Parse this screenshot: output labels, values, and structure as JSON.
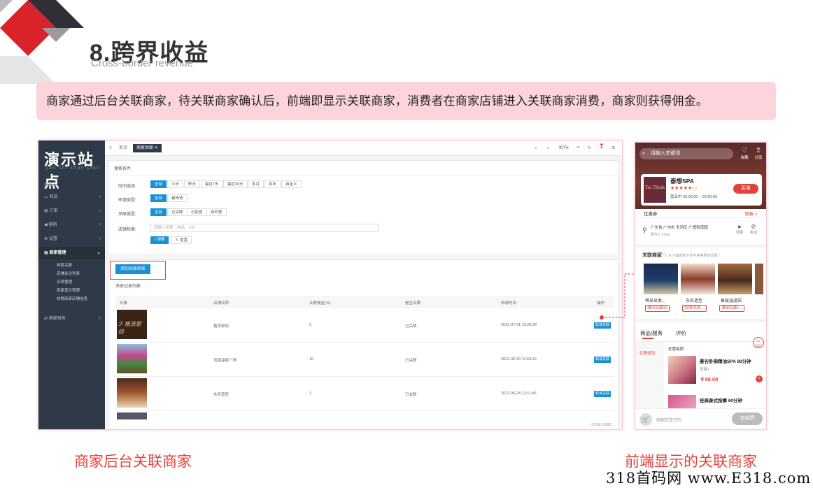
{
  "slide": {
    "title": "8.跨界收益",
    "subtitle": "Cross-border revenue",
    "banner": "商家通过后台关联商家，待关联商家确认后，前端即显示关联商家，消费者在商家店铺进入关联商家消费，商家则获得佣金。",
    "caption_left": "商家后台关联商家",
    "caption_right": "前端显示的关联商家",
    "watermark": "318首码网 www.E318.com"
  },
  "admin": {
    "logo": "演示站点",
    "logo_sub": "yan shi zhan dian",
    "home_label": "商家 ›",
    "menu": [
      {
        "label": "商品",
        "icon": "goods-icon"
      },
      {
        "label": "订单",
        "icon": "order-icon"
      },
      {
        "label": "营销",
        "icon": "marketing-icon"
      },
      {
        "label": "设置",
        "icon": "settings-icon"
      },
      {
        "label": "商家管理",
        "icon": "store-icon"
      },
      {
        "label": "商家财务",
        "icon": "finance-icon"
      }
    ],
    "submenu": [
      "商家关联",
      "店铺关注列表",
      "店员管理",
      "商家显示管理",
      "核销商家店铺信息"
    ],
    "topbar": {
      "home": "首页",
      "tab": "商家关联",
      "close": "关闭"
    },
    "search_title": "搜索条件",
    "filters": [
      {
        "label": "时间选择:",
        "options": [
          "全部",
          "今天",
          "昨天",
          "最近7天",
          "最近30天",
          "本月",
          "本年",
          "自定义"
        ]
      },
      {
        "label": "申请类型:",
        "options": [
          "全部",
          "被申请"
        ]
      },
      {
        "label": "关联类型:",
        "options": [
          "全部",
          "已关联",
          "已拒绝",
          "待同意"
        ]
      }
    ],
    "store_label": "店铺检索:",
    "store_placeholder": "请输入名称、电话、UID",
    "search_btn": "搜索",
    "reset_btn": "重置",
    "add_btn": "添加关联商家",
    "list_title": "关联记录列表",
    "columns": [
      "头像",
      "店铺名称",
      "关联佣金(%)",
      "是否关联",
      "申请时间",
      "操作"
    ],
    "rows": [
      {
        "name": "格茨家纺",
        "commission": "2",
        "status": "已关联",
        "time": "2022-07-01 16:28:28",
        "action": "取消关联"
      },
      {
        "name": "流溪温泉广场",
        "commission": "10",
        "status": "已关联",
        "time": "2022-06-30 11:59:10",
        "action": "取消关联"
      },
      {
        "name": "东尼造型",
        "commission": "2",
        "status": "已关联",
        "time": "2022-06-28 12:11:46",
        "action": "取消关联"
      }
    ],
    "copyright": "© 2017-2020"
  },
  "mobile": {
    "search_placeholder": "请输入关键词",
    "fav": "收藏",
    "share": "分享",
    "shop_name": "泰想SPA",
    "rating": "5.0",
    "hours": "营业中 02:00:00 ~ 23:00:00",
    "buy": "买单",
    "coupon": "优惠券",
    "coupon_more": "领券 >",
    "address": "广东省 广州市 天河区 广值街道园",
    "distance": "距你 7.13km",
    "nav": "地图",
    "phone": "电话",
    "related_title": "关联商家",
    "related_hint": "( 从下面商家下单可获得更多优惠 )",
    "related": [
      {
        "name": "萌采采发...",
        "tag": "满200减50"
      },
      {
        "name": "东尼造型",
        "tag": "仅限洗剪..."
      },
      {
        "name": "象柴温道馆",
        "tag": "满300减1..."
      }
    ],
    "tabs": [
      "商品/服务",
      "评价"
    ],
    "promo": "优惠促销",
    "promo_sub": "优惠促销",
    "product1": "曼谷卧佛精油SPA 80分钟",
    "product1_sales": "销量1",
    "product1_price": "￥99.00",
    "product2": "经典泰式按摩 60分钟",
    "cart_text": "购物车是空的",
    "checkout": "去结算",
    "home_badge": "首页"
  },
  "colors": {
    "accent": "#1890d6",
    "red": "#e5433a",
    "sidebar": "#2e3a48",
    "banner": "#fbd4dc"
  }
}
